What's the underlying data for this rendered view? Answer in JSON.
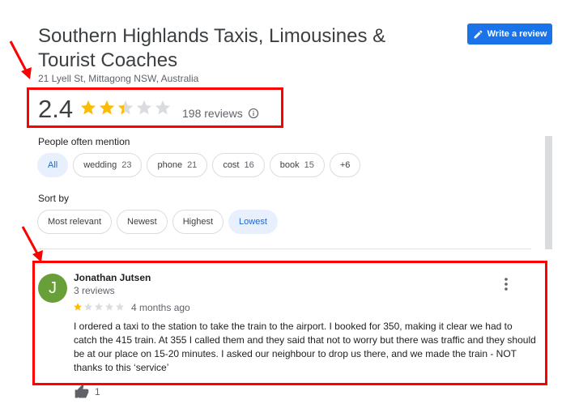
{
  "place": {
    "name": "Southern Highlands Taxis, Limousines & Tourist Coaches",
    "address": "21 Lyell St, Mittagong NSW, Australia"
  },
  "write_review_label": "Write a review",
  "rating": {
    "value": "2.4",
    "stars": 2.4,
    "reviews_label": "198 reviews"
  },
  "mentions": {
    "label": "People often mention",
    "chips": [
      {
        "label": "All",
        "count": ""
      },
      {
        "label": "wedding",
        "count": "23"
      },
      {
        "label": "phone",
        "count": "21"
      },
      {
        "label": "cost",
        "count": "16"
      },
      {
        "label": "book",
        "count": "15"
      },
      {
        "label": "+6",
        "count": ""
      }
    ]
  },
  "sort": {
    "label": "Sort by",
    "options": [
      "Most relevant",
      "Newest",
      "Highest",
      "Lowest"
    ],
    "selected": "Lowest"
  },
  "review": {
    "avatar_letter": "J",
    "avatar_color": "#689f38",
    "name": "Jonathan Jutsen",
    "meta": "3 reviews",
    "stars": 1,
    "date": "4 months ago",
    "text": "I ordered a taxi to the station to take the train to the airport. I booked for 350, making it clear we had to catch the 415 train. At 355 I called them and they said that not to worry but there was traffic and they should be at our place on 15-20 minutes. I asked our neighbour to drop us there, and we made the train - NOT thanks to this ‘service’",
    "likes": "1"
  },
  "colors": {
    "star_filled": "#fbbc04",
    "star_empty": "#dadce0",
    "highlight": "#ff0000",
    "accent": "#1a73e8"
  }
}
